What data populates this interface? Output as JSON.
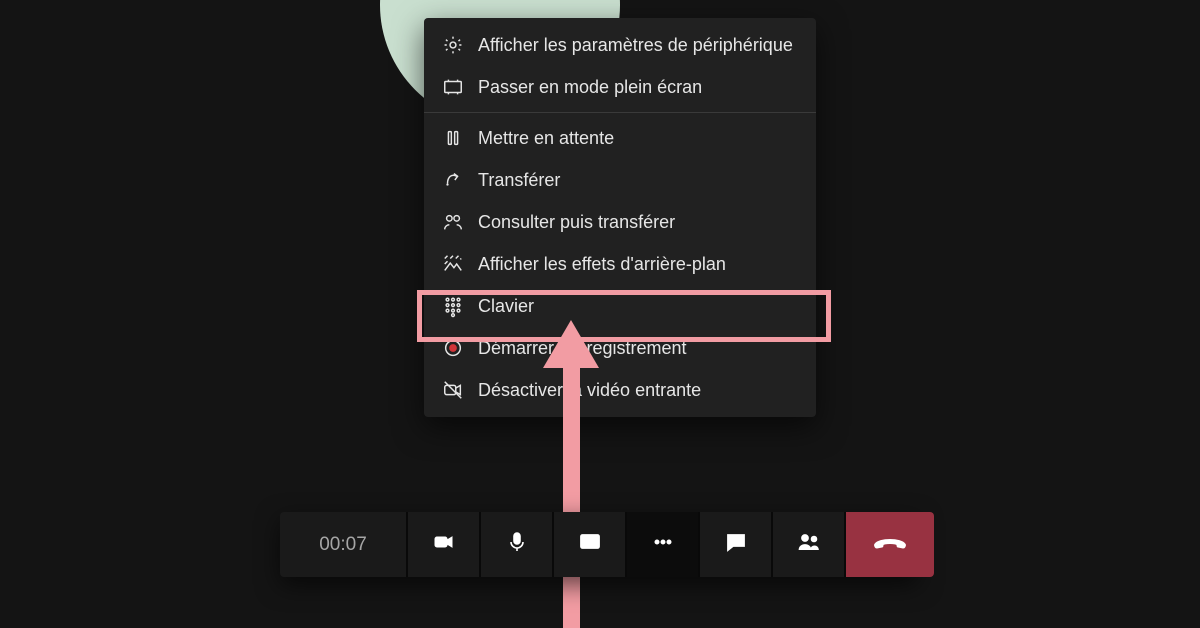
{
  "menu": {
    "device_settings": "Afficher les paramètres de périphérique",
    "fullscreen": "Passer en mode plein écran",
    "hold": "Mettre en attente",
    "transfer": "Transférer",
    "consult_transfer": "Consulter puis transférer",
    "background_effects": "Afficher les effets d'arrière-plan",
    "keypad": "Clavier",
    "start_recording": "Démarrer l'enregistrement",
    "disable_incoming_video": "Désactiver la vidéo entrante"
  },
  "toolbar": {
    "timer": "00:07"
  },
  "colors": {
    "highlight": "#f29ca3",
    "hangup": "#983241"
  }
}
